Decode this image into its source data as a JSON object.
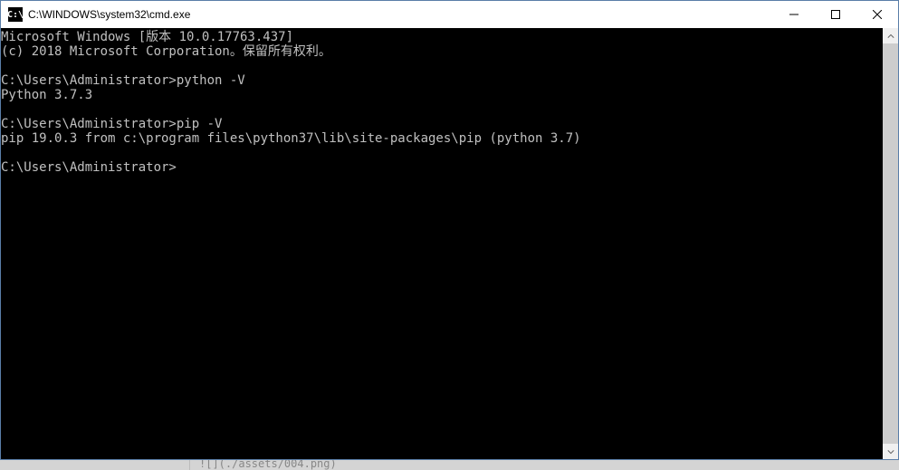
{
  "window": {
    "icon_text": "C:\\",
    "title": "C:\\WINDOWS\\system32\\cmd.exe"
  },
  "terminal": {
    "lines": [
      "Microsoft Windows [版本 10.0.17763.437]",
      "(c) 2018 Microsoft Corporation。保留所有权利。",
      "",
      "C:\\Users\\Administrator>python -V",
      "Python 3.7.3",
      "",
      "C:\\Users\\Administrator>pip -V",
      "pip 19.0.3 from c:\\program files\\python37\\lib\\site-packages\\pip (python 3.7)",
      "",
      "C:\\Users\\Administrator>"
    ]
  },
  "background_fragment": "![](./assets/004.png)"
}
